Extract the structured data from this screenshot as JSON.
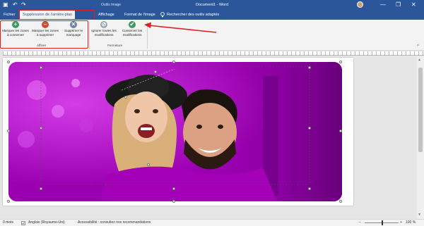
{
  "titlebar": {
    "document_title": "Document1 - Word",
    "context_label": "Outils Image",
    "undo_glyph": "↶",
    "redo_glyph": "↷",
    "save_glyph": "▣",
    "minimize": "—",
    "restore": "❐",
    "close": "✕"
  },
  "tabs": {
    "file": "Fichier",
    "remove_bg": "Suppression de l'arrière-plan",
    "view": "Affichage",
    "format": "Format de l'image",
    "search": "Rechercher des outils adaptés"
  },
  "ribbon": {
    "keep": {
      "label": "Marquer les zones à conserver",
      "glyph": "+"
    },
    "remove": {
      "label": "Marquer les zones à supprimer",
      "glyph": "−"
    },
    "delete_mark": {
      "label": "Supprimer le marquage",
      "glyph": "✕"
    },
    "group_refine": "Affiner",
    "discard": {
      "label": "Ignorer toutes les modifications",
      "glyph": "⊘"
    },
    "keep_changes": {
      "label": "Conserver les modifications",
      "glyph": "✔"
    },
    "group_close": "Fermeture",
    "collapse_glyph": "^"
  },
  "status": {
    "words": "0 mots",
    "language": "Anglais (Royaume-Uni)",
    "accessibility": "Accessibilité : consultez nos recommandations",
    "zoom_minus": "−",
    "zoom_plus": "+",
    "zoom": "100 %"
  },
  "colors": {
    "word_blue": "#2b579a",
    "magenta_overlay": "#b000c8",
    "highlight_red": "#e02020",
    "keep_green": "#3c9a5f",
    "remove_red": "#d04a2f"
  },
  "icons": {
    "search": "search-icon",
    "save": "save-icon",
    "undo": "undo-icon",
    "redo": "redo-icon"
  }
}
